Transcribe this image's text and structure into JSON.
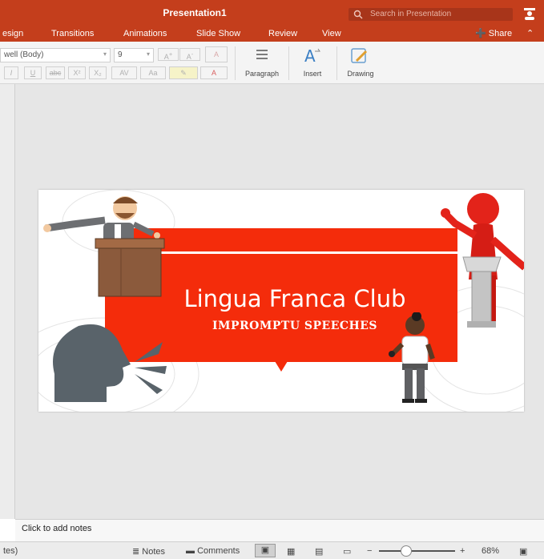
{
  "window": {
    "title": "Presentation1"
  },
  "search": {
    "placeholder": "Search in Presentation"
  },
  "ribbon": {
    "tabs": [
      "esign",
      "Transitions",
      "Animations",
      "Slide Show",
      "Review",
      "View"
    ],
    "share_label": "Share"
  },
  "toolbar": {
    "font_name": "well (Body)",
    "font_size": "9",
    "paragraph_label": "Paragraph",
    "insert_label": "Insert",
    "drawing_label": "Drawing"
  },
  "slide": {
    "title": "Lingua Franca Club",
    "subtitle": "IMPROMPTU SPEECHES",
    "colors": {
      "banner": "#f42c0b",
      "accent": "#c43e1c"
    }
  },
  "notes": {
    "placeholder": "Click to add notes"
  },
  "statusbar": {
    "left_text": "tes)",
    "notes_label": "Notes",
    "comments_label": "Comments",
    "zoom": "68%"
  }
}
